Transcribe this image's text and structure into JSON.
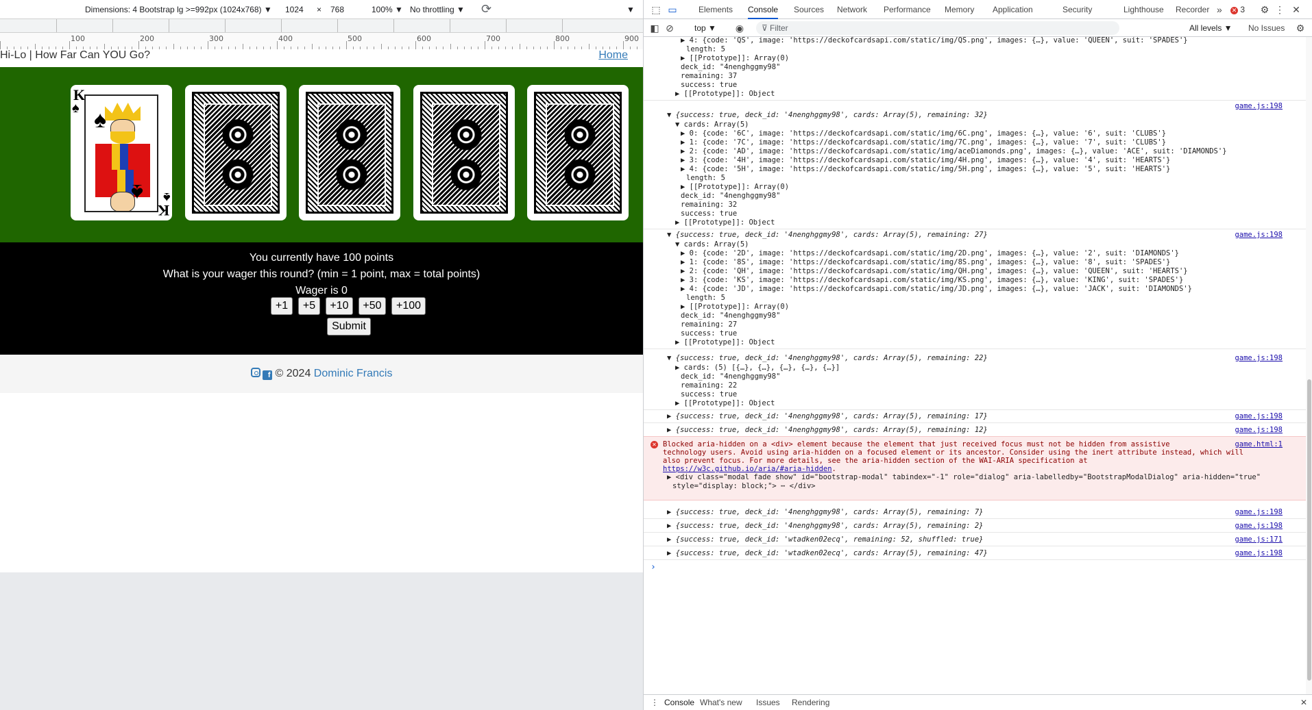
{
  "device_toolbar": {
    "dimensions": "Dimensions: 4 Bootstrap lg >=992px (1024x768) ▼",
    "width": "1024",
    "times": "×",
    "height": "768",
    "zoom": "100% ▼",
    "throttling": "No throttling ▼",
    "more": "▼"
  },
  "rulers": [
    {
      "label": "100"
    },
    {
      "label": "200"
    },
    {
      "label": "300"
    },
    {
      "label": "400"
    },
    {
      "label": "500"
    },
    {
      "label": "600"
    },
    {
      "label": "700"
    },
    {
      "label": "800"
    },
    {
      "label": "900"
    }
  ],
  "site": {
    "title": "Hi-Lo | How Far Can YOU Go?",
    "home_link": "Home"
  },
  "cards": [
    {
      "state": "face",
      "rank": "K",
      "suit": "♠"
    },
    {
      "state": "back"
    },
    {
      "state": "back"
    },
    {
      "state": "back"
    },
    {
      "state": "back"
    }
  ],
  "wager": {
    "points_line": "You currently have 100 points",
    "question": "What is your wager this round? (min = 1 point, max = total points)",
    "wager_line": "Wager is 0",
    "buttons": [
      "+1",
      "+5",
      "+10",
      "+50",
      "+100"
    ],
    "submit": "Submit"
  },
  "footer": {
    "copyright": "© 2024",
    "author": "Dominic Francis",
    "fb_glyph": "f"
  },
  "devtools": {
    "tabs": [
      "Elements",
      "Console",
      "Sources",
      "Network",
      "Performance",
      "Memory",
      "Application",
      "Security",
      "Lighthouse",
      "Recorder"
    ],
    "active_tab": "Console",
    "more_tabs": "»",
    "error_count": "3",
    "context": "top ▼",
    "filter_placeholder": "Filter",
    "levels": "All levels ▼",
    "issues": "No Issues",
    "drawer_tabs": [
      "Console",
      "What's new",
      "Issues",
      "Rendering"
    ],
    "close": "✕",
    "prompt": "›"
  },
  "console": {
    "top_lines": [
      "▶ 4: {code: 'QS', image: 'https://deckofcardsapi.com/static/img/QS.png', images: {…}, value: 'QUEEN', suit: 'SPADES'}",
      "length: 5",
      "▶ [[Prototype]]: Array(0)",
      "deck_id: \"4nenghggmy98\"",
      "remaining: 37",
      "success: true",
      "▶ [[Prototype]]: Object"
    ],
    "group1": {
      "summary": "▼ {success: true, deck_id: '4nenghggmy98', cards: Array(5), remaining: 32}",
      "source": "game.js:198",
      "cards_header": "▼ cards: Array(5)",
      "cards": [
        "▶ 0: {code: '6C', image: 'https://deckofcardsapi.com/static/img/6C.png', images: {…}, value: '6', suit: 'CLUBS'}",
        "▶ 1: {code: '7C', image: 'https://deckofcardsapi.com/static/img/7C.png', images: {…}, value: '7', suit: 'CLUBS'}",
        "▶ 2: {code: 'AD', image: 'https://deckofcardsapi.com/static/img/aceDiamonds.png', images: {…}, value: 'ACE', suit: 'DIAMONDS'}",
        "▶ 3: {code: '4H', image: 'https://deckofcardsapi.com/static/img/4H.png', images: {…}, value: '4', suit: 'HEARTS'}",
        "▶ 4: {code: '5H', image: 'https://deckofcardsapi.com/static/img/5H.png', images: {…}, value: '5', suit: 'HEARTS'}"
      ],
      "tail": [
        "length: 5",
        "▶ [[Prototype]]: Array(0)",
        "deck_id: \"4nenghggmy98\"",
        "remaining: 32",
        "success: true",
        "▶ [[Prototype]]: Object"
      ]
    },
    "group2": {
      "summary": "▼ {success: true, deck_id: '4nenghggmy98', cards: Array(5), remaining: 27}",
      "source": "game.js:198",
      "cards_header": "▼ cards: Array(5)",
      "cards": [
        "▶ 0: {code: '2D', image: 'https://deckofcardsapi.com/static/img/2D.png', images: {…}, value: '2', suit: 'DIAMONDS'}",
        "▶ 1: {code: '8S', image: 'https://deckofcardsapi.com/static/img/8S.png', images: {…}, value: '8', suit: 'SPADES'}",
        "▶ 2: {code: 'QH', image: 'https://deckofcardsapi.com/static/img/QH.png', images: {…}, value: 'QUEEN', suit: 'HEARTS'}",
        "▶ 3: {code: 'KS', image: 'https://deckofcardsapi.com/static/img/KS.png', images: {…}, value: 'KING', suit: 'SPADES'}",
        "▶ 4: {code: 'JD', image: 'https://deckofcardsapi.com/static/img/JD.png', images: {…}, value: 'JACK', suit: 'DIAMONDS'}"
      ],
      "tail": [
        "length: 5",
        "▶ [[Prototype]]: Array(0)",
        "deck_id: \"4nenghggmy98\"",
        "remaining: 27",
        "success: true",
        "▶ [[Prototype]]: Object"
      ]
    },
    "group3": {
      "summary": "▼ {success: true, deck_id: '4nenghggmy98', cards: Array(5), remaining: 22}",
      "source": "game.js:198",
      "lines": [
        "▶ cards: (5) [{…}, {…}, {…}, {…}, {…}]",
        "deck_id: \"4nenghggmy98\"",
        "remaining: 22",
        "success: true",
        "▶ [[Prototype]]: Object"
      ]
    },
    "collapsed_a": [
      {
        "text": "▶ {success: true, deck_id: '4nenghggmy98', cards: Array(5), remaining: 17}",
        "source": "game.js:198"
      },
      {
        "text": "▶ {success: true, deck_id: '4nenghggmy98', cards: Array(5), remaining: 12}",
        "source": "game.js:198"
      }
    ],
    "error": {
      "icon": "✕",
      "source": "game.html:1",
      "lines": [
        "Blocked aria-hidden on a <div> element because the element that just received focus must not be hidden from assistive",
        "technology users. Avoid using aria-hidden on a focused element or its ancestor. Consider using the inert attribute instead, which will",
        "also prevent focus. For more details, see the aria-hidden section of the WAI-ARIA specification at"
      ],
      "url": "https://w3c.github.io/aria/#aria-hidden",
      "url_suffix": ".",
      "element_line1": "▶ <div class=\"modal fade show\" id=\"bootstrap-modal\" tabindex=\"-1\" role=\"dialog\" aria-labelledby=\"BootstrapModalDialog\" aria-hidden=\"true\"",
      "element_line2": "style=\"display: block;\"> ⋯ </div>"
    },
    "collapsed_b": [
      {
        "text": "▶ {success: true, deck_id: '4nenghggmy98', cards: Array(5), remaining: 7}",
        "source": "game.js:198"
      },
      {
        "text": "▶ {success: true, deck_id: '4nenghggmy98', cards: Array(5), remaining: 2}",
        "source": "game.js:198"
      },
      {
        "text": "▶ {success: true, deck_id: 'wtadken02ecq', remaining: 52, shuffled: true}",
        "source": "game.js:171"
      },
      {
        "text": "▶ {success: true, deck_id: 'wtadken02ecq', cards: Array(5), remaining: 47}",
        "source": "game.js:198"
      }
    ]
  }
}
